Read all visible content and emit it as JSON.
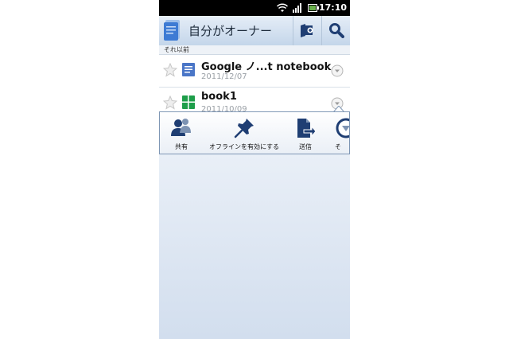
{
  "status": {
    "time": "17:10"
  },
  "header": {
    "title": "自分がオーナー"
  },
  "section_label": "それ以前",
  "documents": [
    {
      "name": "Google ノ...t notebook",
      "date": "2011/12/07",
      "icon": "document-icon"
    },
    {
      "name": "book1",
      "date": "2011/10/09",
      "icon": "spreadsheet-icon"
    }
  ],
  "quick_actions": [
    {
      "label": "共有",
      "icon": "share-people-icon"
    },
    {
      "label": "オフラインを有効にする",
      "icon": "pin-icon"
    },
    {
      "label": "送信",
      "icon": "send-icon"
    },
    {
      "label": "そ",
      "icon": "more-icon"
    }
  ],
  "colors": {
    "accent": "#1f3e73",
    "actionbar": "#c4d6ea",
    "spreadsheet": "#1e9e4a",
    "document": "#4a76c7"
  }
}
